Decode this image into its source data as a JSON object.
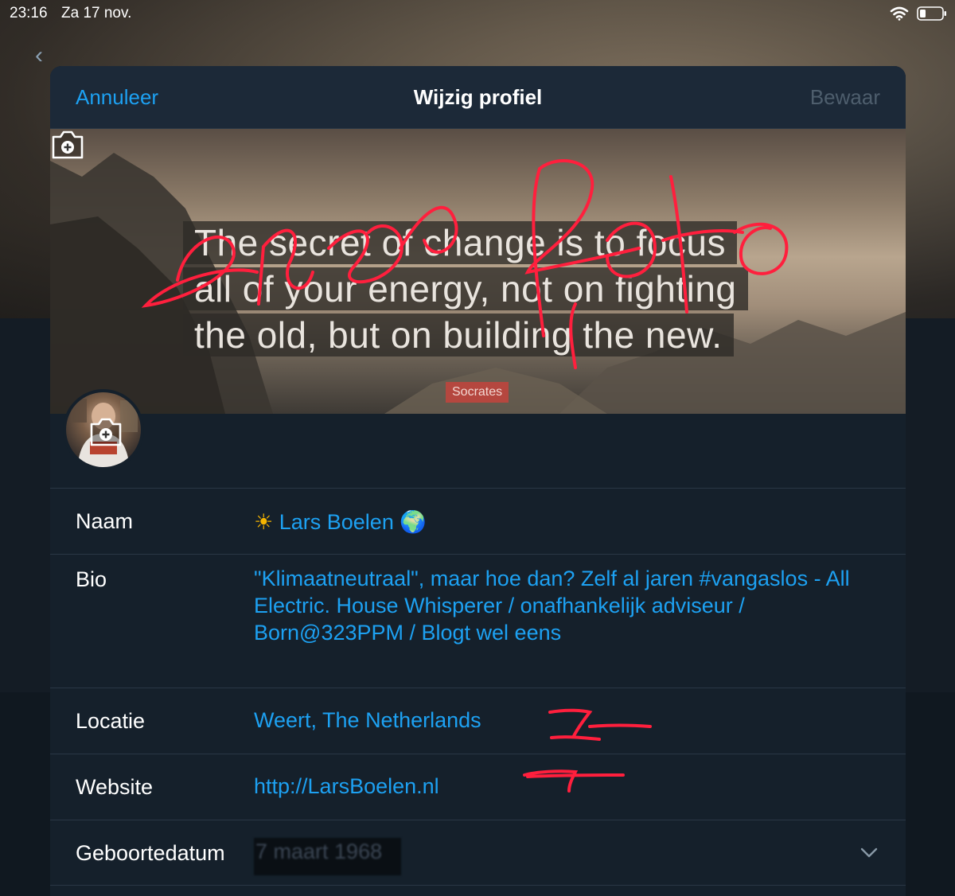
{
  "status_bar": {
    "time": "23:16",
    "date": "Za 17 nov."
  },
  "header": {
    "cancel_label": "Annuleer",
    "title": "Wijzig profiel",
    "save_label": "Bewaar"
  },
  "banner": {
    "quote_lines": [
      "The secret of change is to focus",
      "all of your energy, not on fighting",
      "the old, but on building the new."
    ],
    "author": "Socrates",
    "annotation": "eigen foto"
  },
  "fields": {
    "name": {
      "label": "Naam",
      "value": "Lars Boelen",
      "prefix_icon": "sun-emoji",
      "suffix_icon": "globe-emoji"
    },
    "bio": {
      "label": "Bio",
      "value_lines": [
        "\"Klimaatneutraal\", maar hoe dan? Zelf al jaren #vangaslos - All",
        "Electric. House Whisperer / onafhankelijk adviseur /",
        "Born@323PPM / Blogt wel eens"
      ]
    },
    "location": {
      "label": "Locatie",
      "value": "Weert, The Netherlands"
    },
    "website": {
      "label": "Website",
      "value": "http://LarsBoelen.nl"
    },
    "birthdate": {
      "label": "Geboortedatum",
      "value": "7 maart 1968"
    }
  },
  "colors": {
    "accent": "#1da1f2",
    "background": "#15202b",
    "header": "#1c2938",
    "divider": "#2a3745",
    "annotation": "#ff1f3d"
  }
}
